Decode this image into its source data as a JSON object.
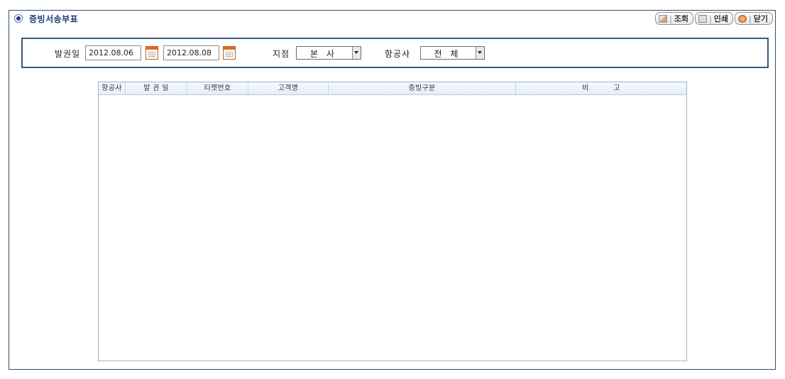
{
  "page": {
    "title": "증빙서송부표"
  },
  "toolbar": {
    "search_label": "조회",
    "print_label": "인쇄",
    "close_label": "닫기",
    "separator": "|"
  },
  "filters": {
    "issue_date_label": "발권일",
    "date_from": "2012.08.06",
    "date_to": "2012.08.08",
    "branch_label": "지점",
    "branch_value": "본 사",
    "airline_label": "항공사",
    "airline_value": "전 체"
  },
  "grid": {
    "columns": [
      "항공사",
      "발 권 일",
      "티켓번호",
      "고객명",
      "증빙구분",
      "비          고"
    ],
    "rows": []
  },
  "colors": {
    "title": "#1a3d7c",
    "frame_border": "#2f4f6f",
    "grid_border": "#9ab4cf",
    "calendar_accent": "#e06a21"
  },
  "icons": {
    "title_bullet": "radio-bullet-icon",
    "search": "search-icon",
    "print": "printer-icon",
    "close": "close-icon",
    "calendar": "calendar-icon",
    "dropdown": "chevron-down-icon"
  }
}
